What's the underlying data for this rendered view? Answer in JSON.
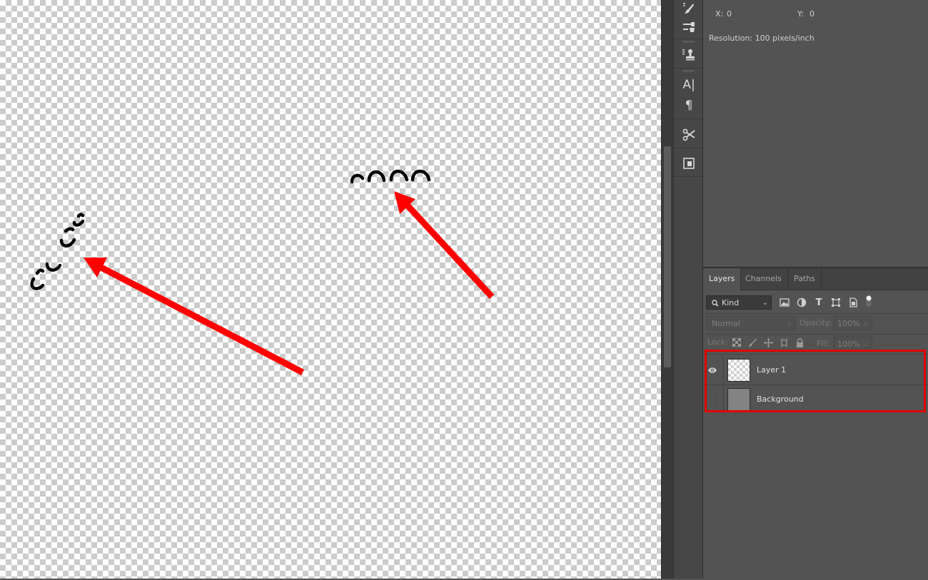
{
  "info_panel": {
    "x_label": "X:",
    "x_value": "0",
    "y_label": "Y:",
    "y_value": "0",
    "resolution": "Resolution: 100 pixels/inch"
  },
  "tool_strip": {
    "buttons": [
      "brush-settings-icon",
      "brush-presets-icon",
      "clone-source-icon",
      "character-icon",
      "paragraph-icon",
      "tool-presets-icon",
      "properties-icon"
    ],
    "character_glyph": "A|",
    "paragraph_glyph": "¶"
  },
  "layers_panel": {
    "tabs": [
      {
        "label": "Layers",
        "active": true
      },
      {
        "label": "Channels",
        "active": false
      },
      {
        "label": "Paths",
        "active": false
      }
    ],
    "filter": {
      "kind_label": "Kind",
      "icons": [
        "image-filter-icon",
        "adjustment-filter-icon",
        "type-filter-icon",
        "shape-filter-icon",
        "smart-object-filter-icon",
        "filter-toggle-icon"
      ]
    },
    "blend_mode": "Normal",
    "opacity_label": "Opacity:",
    "opacity_value": "100%",
    "lock_label": "Lock:",
    "fill_label": "Fill:",
    "fill_value": "100%",
    "layers": [
      {
        "name": "Layer 1",
        "visible": true,
        "thumbnail": "transparent"
      },
      {
        "name": "Background",
        "visible": false,
        "thumbnail": "gray"
      }
    ]
  },
  "annotations": {
    "arrow_color": "#ff0000",
    "highlight_color": "#e00000"
  }
}
